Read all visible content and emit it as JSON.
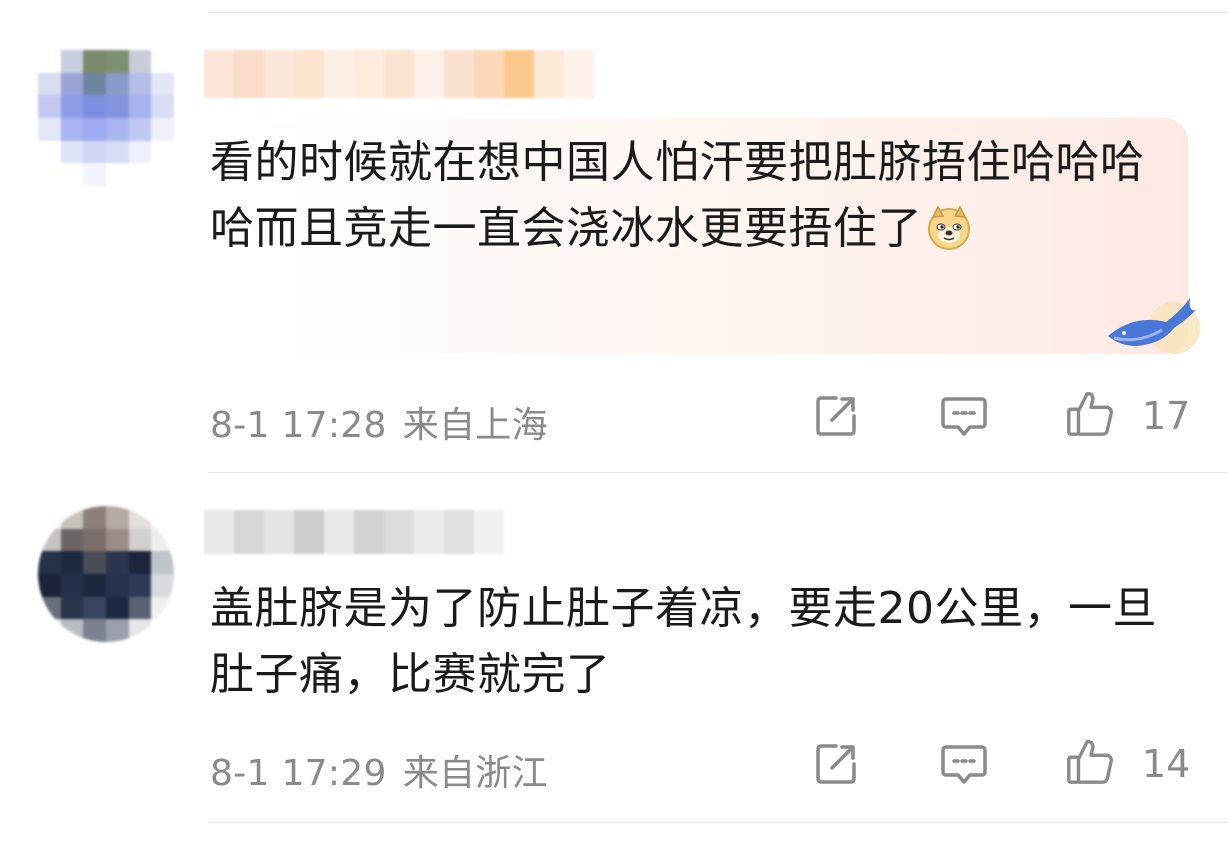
{
  "comments": [
    {
      "text": "看的时候就在想中国人怕汗要把肚脐捂住哈哈哈哈而且竞走一直会浇冰水更要捂住了",
      "emoji": "doge-emoji",
      "time": "8-1 17:28",
      "region": "来自上海",
      "like_count": "17"
    },
    {
      "text": "盖肚脐是为了防止肚子着凉，要走20公里，一旦肚子痛，比赛就完了",
      "time": "8-1 17:29",
      "region": "来自浙江",
      "like_count": "14"
    }
  ],
  "icons": {
    "repost": "share-edit-icon",
    "comment": "comment-bubble-icon",
    "like": "thumbs-up-icon"
  },
  "colors": {
    "text": "#1a1a1a",
    "meta": "#8a8a8a",
    "highlight": "#fde8e2",
    "whale": "#4a78d8"
  }
}
